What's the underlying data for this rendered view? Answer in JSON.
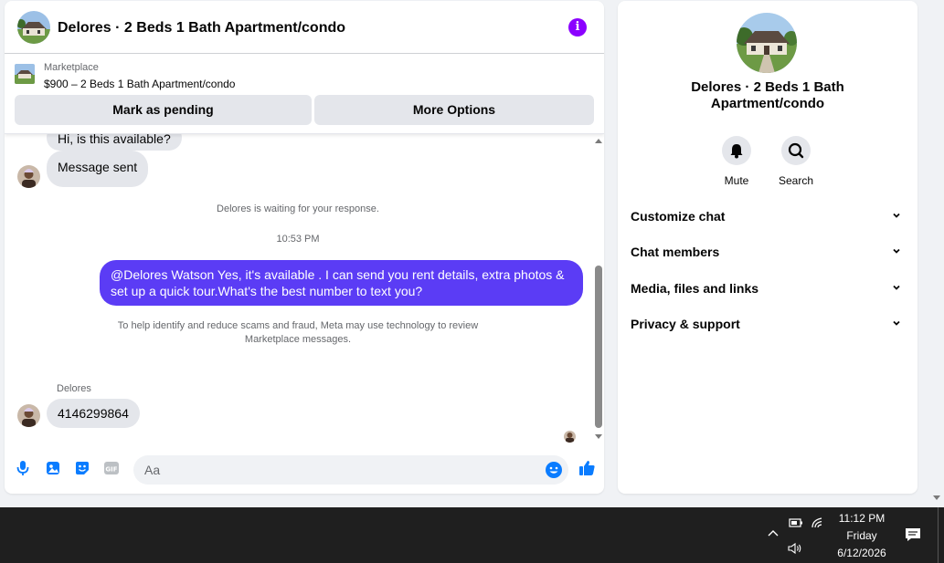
{
  "chat": {
    "header_title": "Delores · 2 Beds 1 Bath Apartment/condo",
    "listing_source": "Marketplace",
    "listing_price": "$900 – 2 Beds 1 Bath Apartment/condo",
    "btn_pending": "Mark as pending",
    "btn_more": "More Options"
  },
  "messages": {
    "prev_partial": "Hi, is this available?",
    "sent_notice": "Message sent",
    "waiting": "Delores is waiting for your response.",
    "time": "10:53 PM",
    "outgoing": "@Delores Watson Yes, it's available .  I can send you rent details, extra photos & set up a quick tour.What's the best number to text you?",
    "scam_notice": "To help identify and reduce scams and fraud, Meta may use technology to review Marketplace messages.",
    "sender_name": "Delores",
    "incoming_number": "4146299864"
  },
  "composer": {
    "placeholder": "Aa"
  },
  "info_panel": {
    "title": "Delores · 2 Beds 1 Bath Apartment/condo",
    "mute_label": "Mute",
    "search_label": "Search",
    "sections": [
      "Customize chat",
      "Chat members",
      "Media, files and links",
      "Privacy & support"
    ]
  },
  "taskbar": {
    "time": "11:12 PM",
    "day": "Friday",
    "date": "6/12/2026"
  },
  "colors": {
    "accent": "#5b3cf5",
    "info_purple": "#8b00ff",
    "like_blue": "#0a7cff",
    "bubble_grey": "#e4e6eb"
  }
}
